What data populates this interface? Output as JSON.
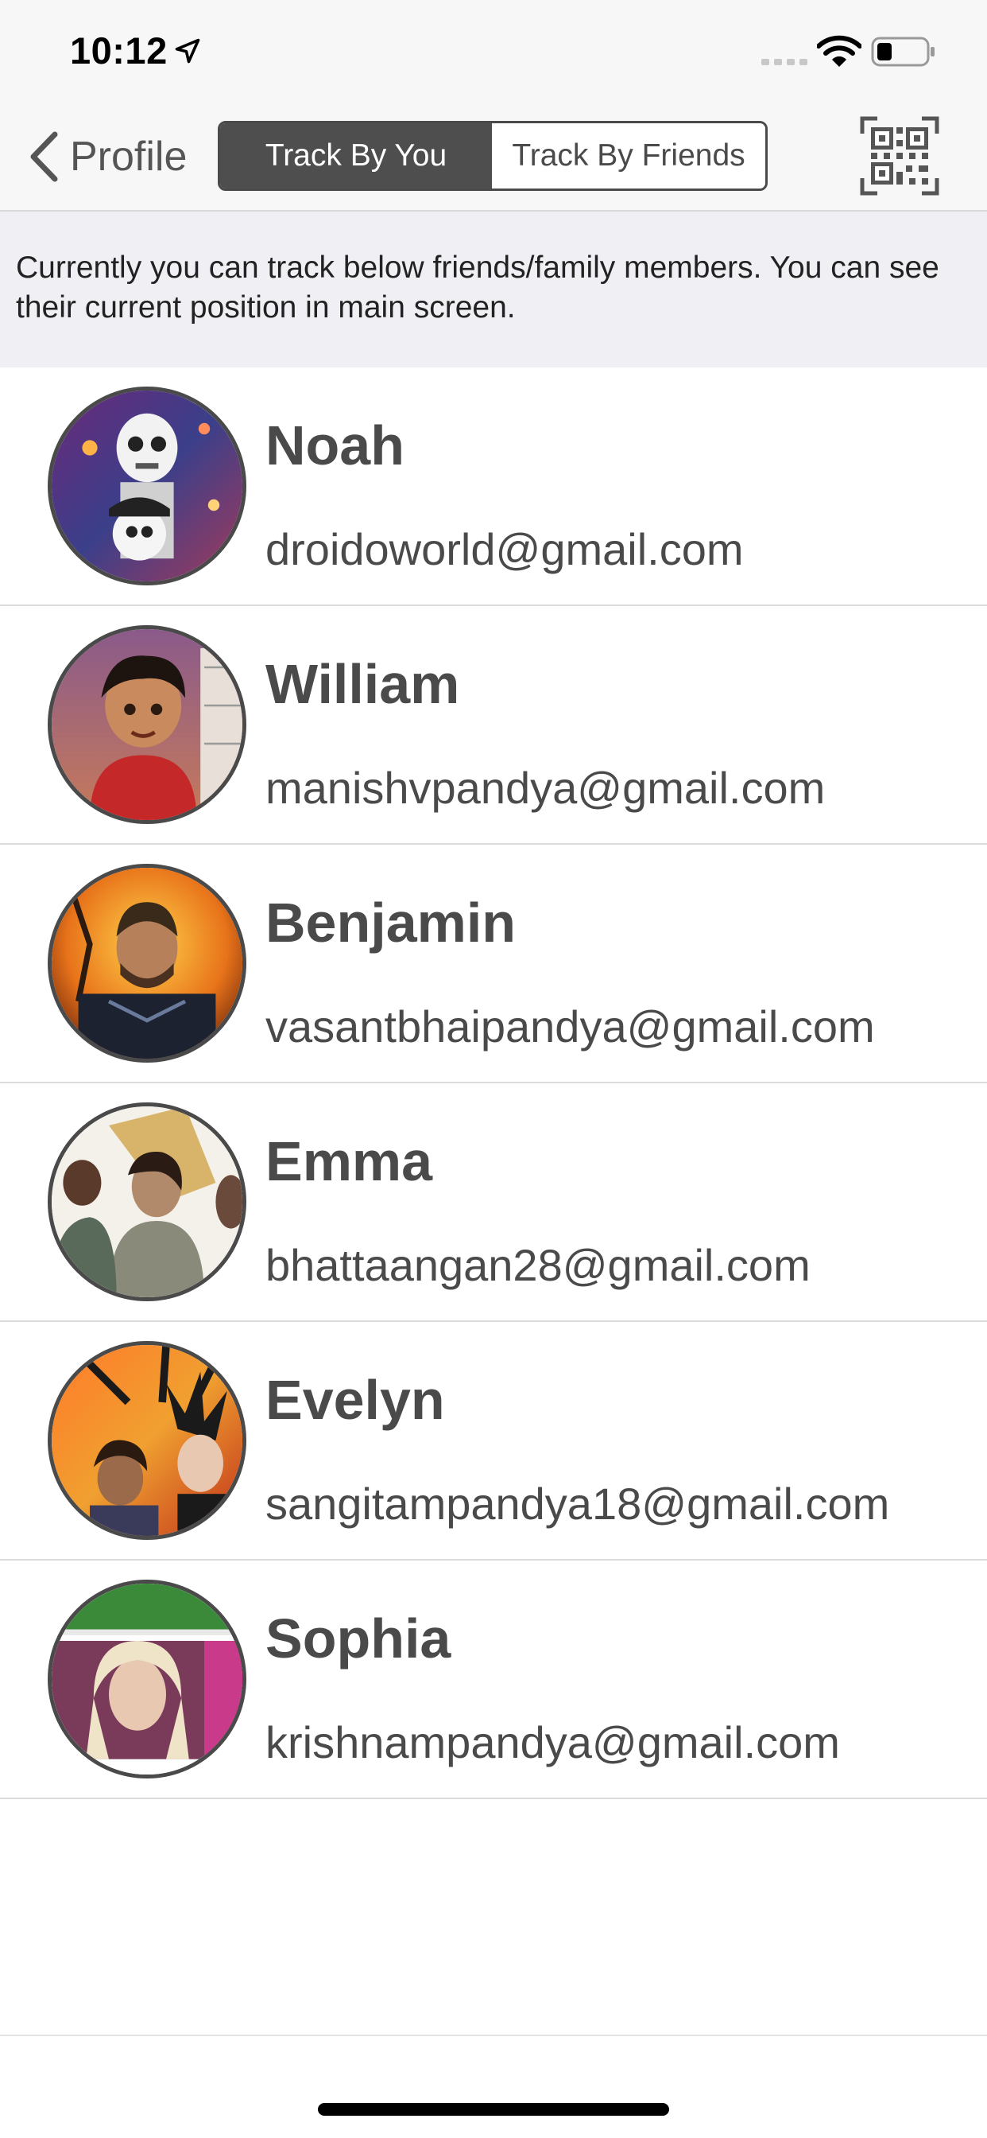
{
  "status_bar": {
    "time": "10:12",
    "icons": [
      "location-arrow-icon",
      "signal-dots-icon",
      "wifi-icon",
      "battery-icon"
    ]
  },
  "nav": {
    "back_label": "Profile",
    "back_icon": "chevron-left-icon",
    "segments": [
      {
        "label": "Track By You",
        "selected": true
      },
      {
        "label": "Track By Friends",
        "selected": false
      }
    ],
    "qr_icon": "qr-code-icon"
  },
  "info_text": "Currently you can track below friends/family members. You can see their current position in main screen.",
  "contacts": [
    {
      "name": "Noah",
      "email": "droidoworld@gmail.com"
    },
    {
      "name": "William",
      "email": "manishvpandya@gmail.com"
    },
    {
      "name": "Benjamin",
      "email": "vasantbhaipandya@gmail.com"
    },
    {
      "name": "Emma",
      "email": "bhattaangan28@gmail.com"
    },
    {
      "name": "Evelyn",
      "email": "sangitampandya18@gmail.com"
    },
    {
      "name": "Sophia",
      "email": "krishnampandya@gmail.com"
    }
  ],
  "colors": {
    "bar_background": "#f7f7f7",
    "segment_active": "#4e4e4e",
    "text_primary": "#4a4a4a",
    "banner_background": "#efeff4"
  }
}
